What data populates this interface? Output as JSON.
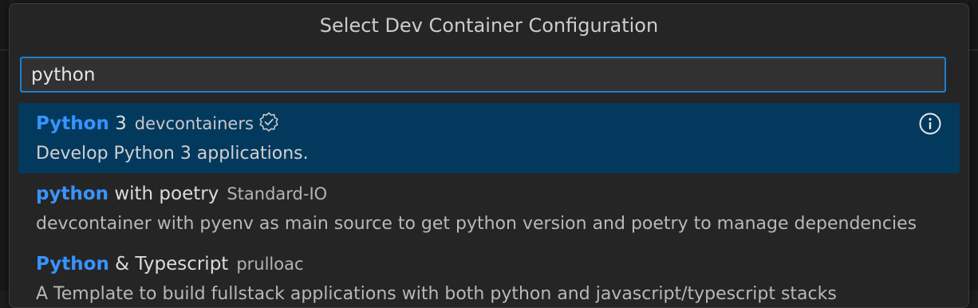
{
  "dialog": {
    "title": "Select Dev Container Configuration"
  },
  "search": {
    "value": "python",
    "placeholder": ""
  },
  "items": [
    {
      "match": "Python",
      "label_rest": " 3",
      "publisher": "devcontainers",
      "verified": true,
      "description": "Develop Python 3 applications.",
      "selected": true,
      "action_icon": "info-icon"
    },
    {
      "match": "python",
      "label_rest": " with poetry",
      "publisher": "Standard-IO",
      "verified": false,
      "description": "devcontainer with pyenv as main source to get python version and poetry to manage dependencies",
      "selected": false
    },
    {
      "match": "Python",
      "label_rest": " & Typescript",
      "publisher": "prulloac",
      "verified": false,
      "description": "A Template to build fullstack applications with both python and javascript/typescript stacks",
      "selected": false
    }
  ],
  "colors": {
    "accent": "#3794ff",
    "selection_bg": "#04395e",
    "input_border": "#1f7fd0"
  }
}
